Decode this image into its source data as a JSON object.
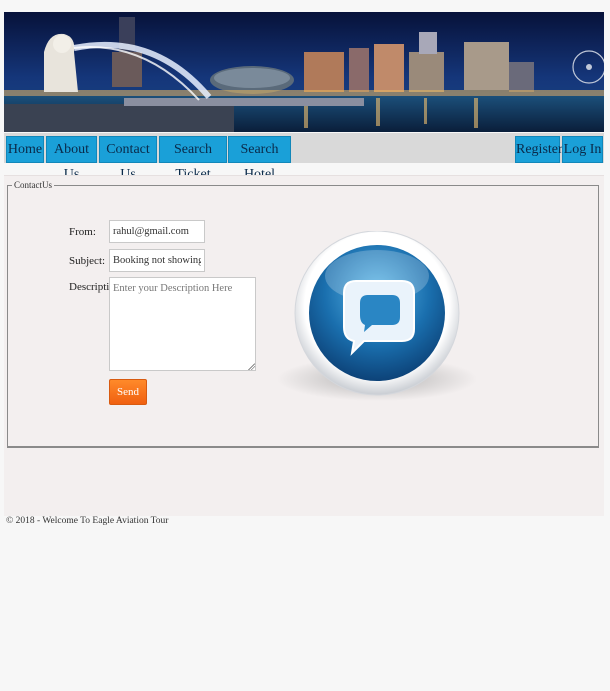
{
  "nav": {
    "home": "Home",
    "about": "About Us",
    "contact": "Contact Us",
    "search_ticket": "Search Ticket",
    "search_hotel": "Search Hotel",
    "register": "Register",
    "login": "Log In"
  },
  "contact_form": {
    "legend": "ContactUs",
    "from_label": "From:",
    "from_value": "rahul@gmail.com",
    "subject_label": "Subject:",
    "subject_value": "Booking not showing",
    "description_label": "Description:",
    "description_placeholder": "Enter your Description Here",
    "send_label": "Send"
  },
  "footer": {
    "text": "© 2018 - Welcome To Eagle Aviation Tour"
  },
  "colors": {
    "nav_button": "#1aa0d8",
    "send_button": "#f06010",
    "content_background": "#f3efef"
  },
  "icons": {
    "contact_logo": "chat-bubble-globe-icon"
  }
}
